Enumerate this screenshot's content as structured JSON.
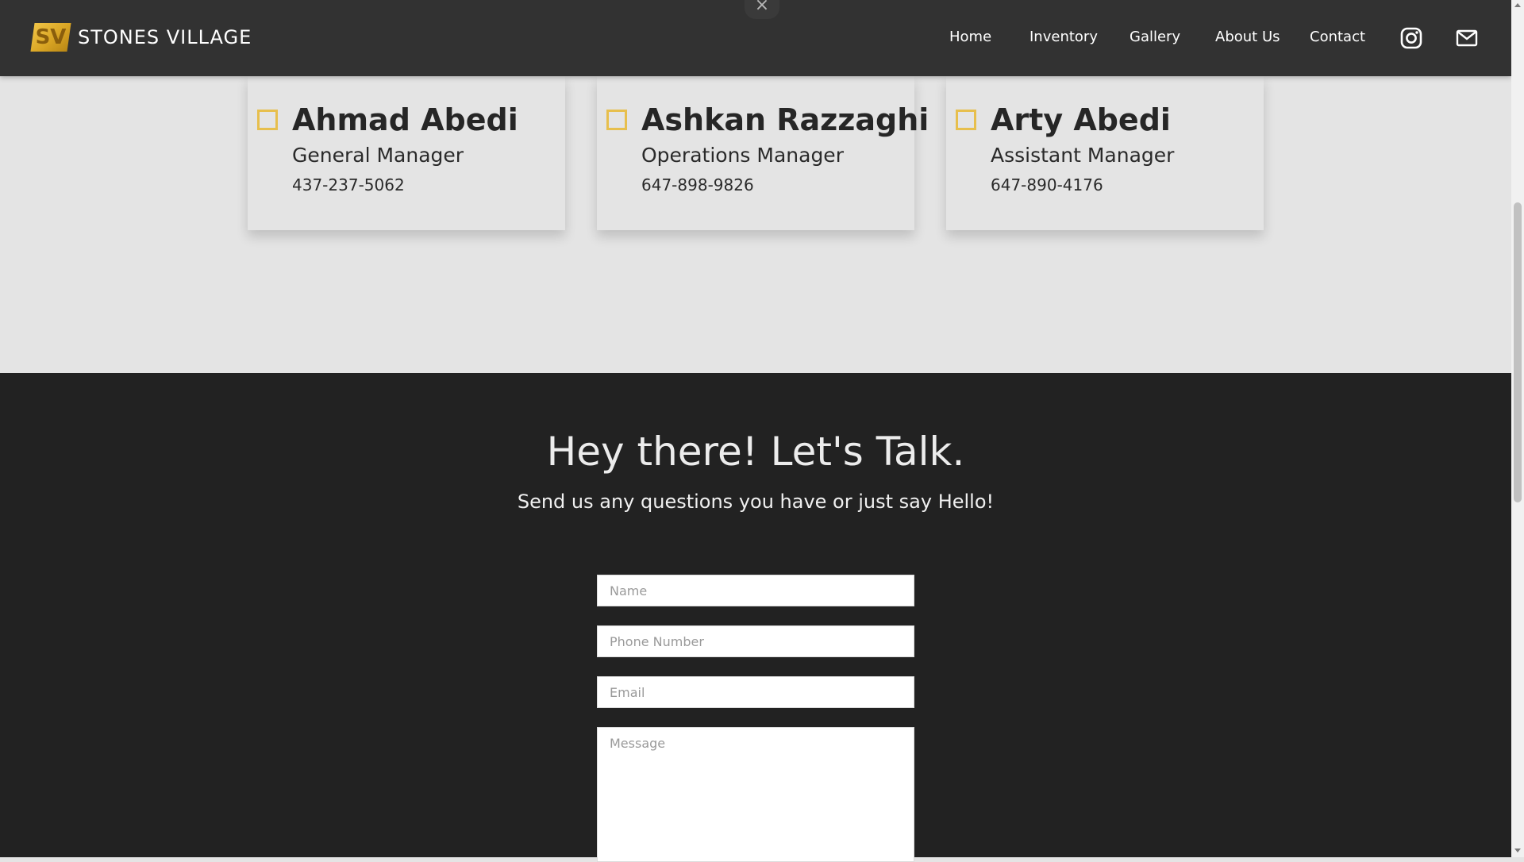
{
  "header": {
    "logo_mark": "SV",
    "logo_text": "STONES VILLAGE",
    "nav": [
      "Home",
      "Inventory",
      "Gallery",
      "About Us",
      "Contact"
    ],
    "icons": [
      "instagram-icon",
      "mail-icon"
    ],
    "close_glyph": "×"
  },
  "team": [
    {
      "name": "Ahmad Abedi",
      "role": "General Manager",
      "phone": "437-237-5062"
    },
    {
      "name": "Ashkan Razzaghi",
      "role": "Operations Manager",
      "phone": "647-898-9826"
    },
    {
      "name": "Arty Abedi",
      "role": "Assistant Manager",
      "phone": "647-890-4176"
    }
  ],
  "contact": {
    "title": "Hey there! Let's Talk.",
    "subtitle": "Send us any questions you have or just say Hello!",
    "fields": {
      "name_placeholder": "Name",
      "phone_placeholder": "Phone Number",
      "email_placeholder": "Email",
      "message_placeholder": "Message"
    }
  },
  "colors": {
    "header_bg": "#323232",
    "accent": "#e7bf4d",
    "section_light": "#e4e4e4",
    "section_dark": "#222222"
  }
}
